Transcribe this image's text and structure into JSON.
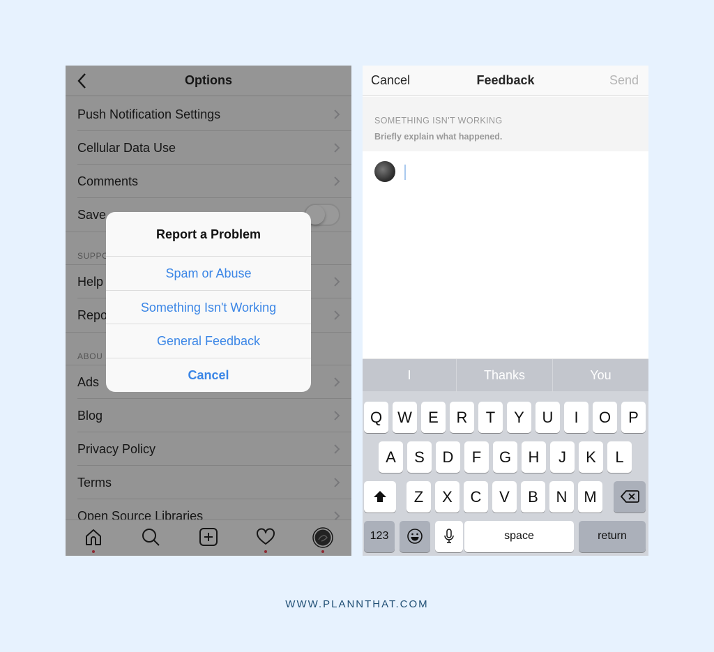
{
  "left": {
    "header": {
      "title": "Options",
      "back_icon": "chevron-left-icon"
    },
    "rows": [
      {
        "type": "item",
        "label": "Push Notification Settings"
      },
      {
        "type": "item",
        "label": "Cellular Data Use"
      },
      {
        "type": "item",
        "label": "Comments"
      },
      {
        "type": "toggle",
        "label": "Save Original Photos",
        "visible_label": "Save",
        "on": false
      },
      {
        "type": "section",
        "label": "SUPPORT"
      },
      {
        "type": "item",
        "label": "Help Center",
        "visible_label": "Help"
      },
      {
        "type": "item",
        "label": "Report a Problem",
        "visible_label": "Repo"
      },
      {
        "type": "section",
        "label": "ABOUT"
      },
      {
        "type": "item",
        "label": "Ads"
      },
      {
        "type": "item",
        "label": "Blog"
      },
      {
        "type": "item",
        "label": "Privacy Policy"
      },
      {
        "type": "item",
        "label": "Terms"
      },
      {
        "type": "item",
        "label": "Open Source Libraries"
      }
    ],
    "visible_rows": {
      "r0": "Push Notification Settings",
      "r1": "Cellular Data Use",
      "r2": "Comments",
      "r3": "Save",
      "s0": "SUPPO",
      "r4": "Help",
      "r5": "Repo",
      "s1": "ABOU",
      "r6": "Ads",
      "r7": "Blog",
      "r8": "Privacy Policy",
      "r9": "Terms",
      "r10": "Open Source Libraries"
    },
    "tabbar": [
      "home-icon",
      "search-icon",
      "add-post-icon",
      "activity-heart-icon",
      "profile-avatar-icon"
    ],
    "alert": {
      "title": "Report a Problem",
      "options": [
        "Spam or Abuse",
        "Something Isn't Working",
        "General Feedback"
      ],
      "cancel": "Cancel"
    }
  },
  "right": {
    "header": {
      "cancel": "Cancel",
      "title": "Feedback",
      "send": "Send"
    },
    "info": {
      "heading": "SOMETHING ISN'T WORKING",
      "subtext": "Briefly explain what happened."
    },
    "input_value": "",
    "keyboard": {
      "suggestions": [
        "I",
        "Thanks",
        "You"
      ],
      "row1": [
        "Q",
        "W",
        "E",
        "R",
        "T",
        "Y",
        "U",
        "I",
        "O",
        "P"
      ],
      "row2": [
        "A",
        "S",
        "D",
        "F",
        "G",
        "H",
        "J",
        "K",
        "L"
      ],
      "row3": [
        "Z",
        "X",
        "C",
        "V",
        "B",
        "N",
        "M"
      ],
      "numbers": "123",
      "space": "space",
      "return": "return"
    }
  },
  "colors": {
    "background": "#e7f2fe",
    "alert_blue": "#3b86e6",
    "notification_dot": "#ed4956",
    "footer_text": "#1f4e74"
  },
  "footer": "WWW.PLANNTHAT.COM"
}
